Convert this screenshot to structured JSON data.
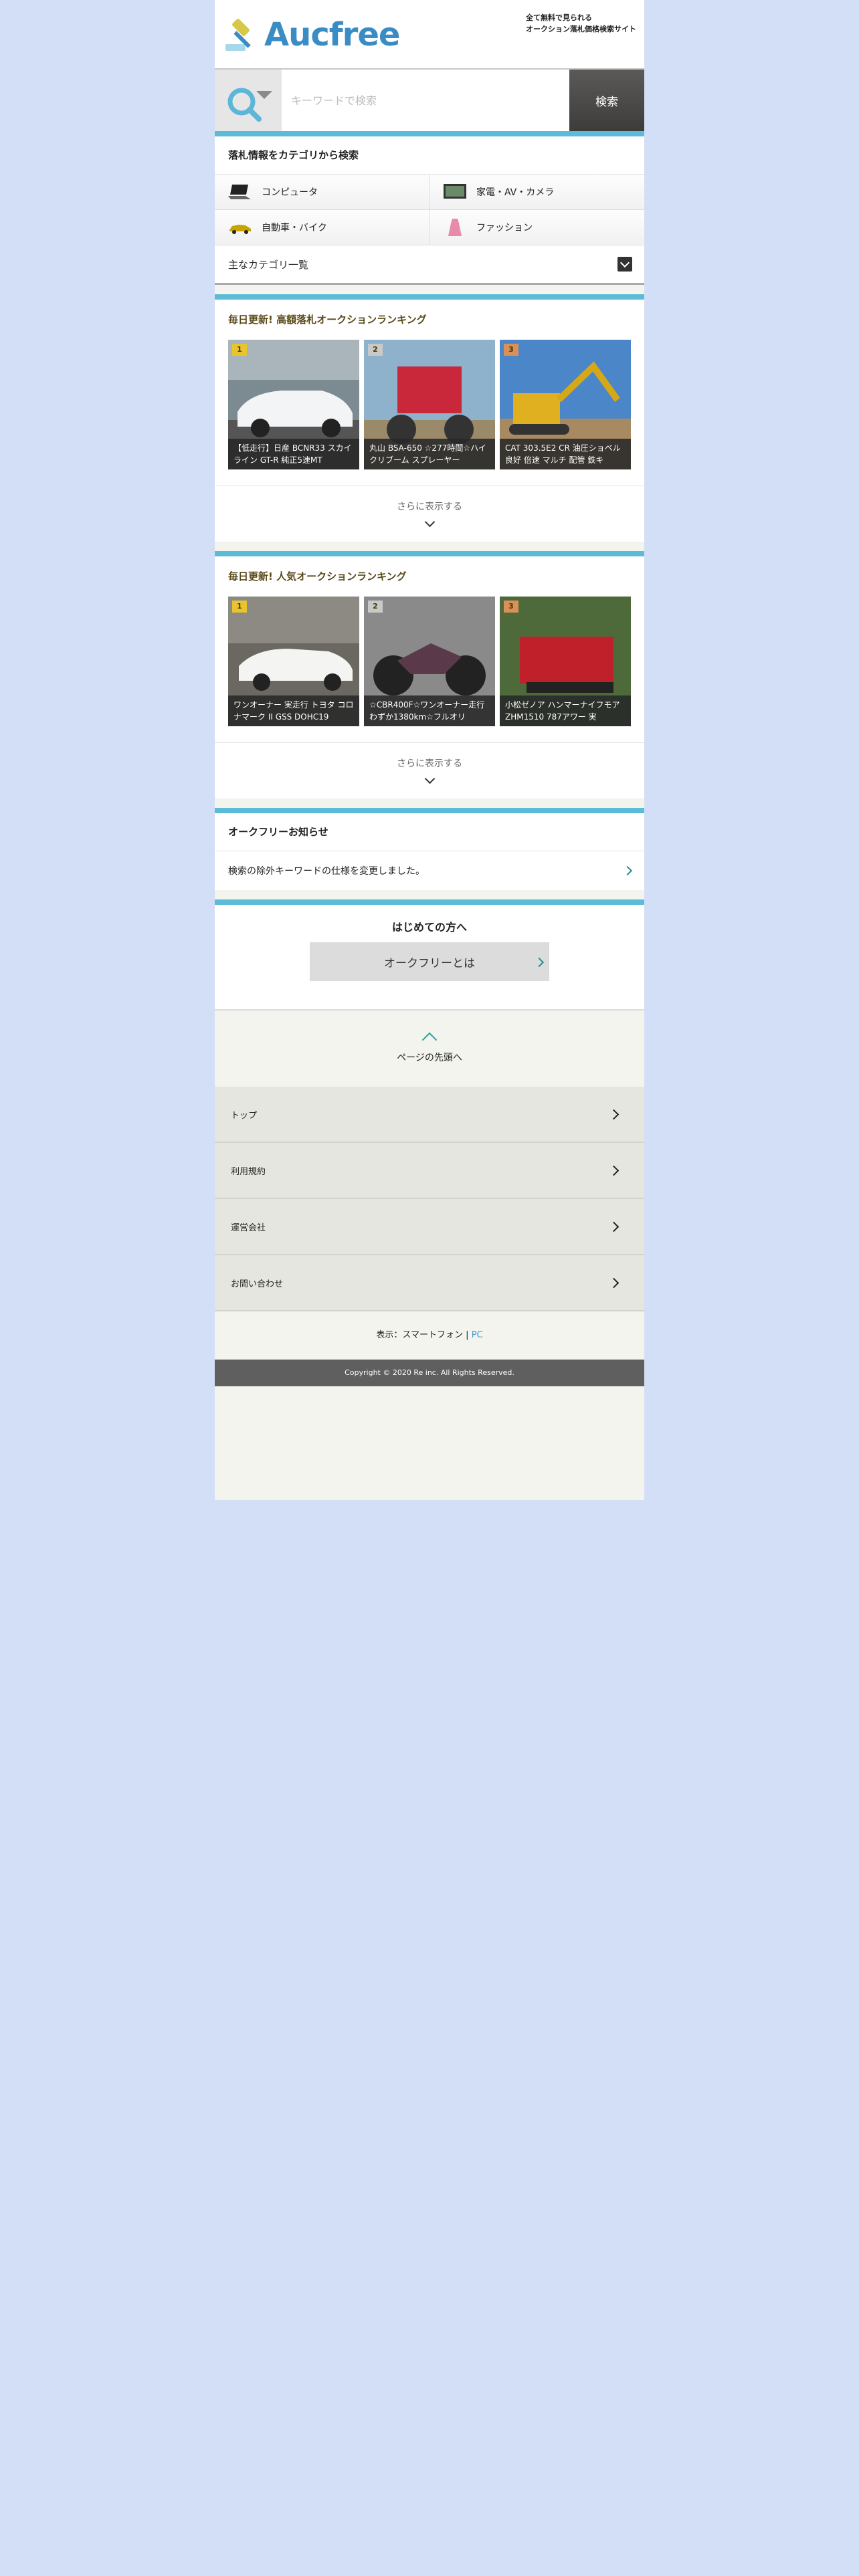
{
  "header": {
    "logo_text": "Aucfree",
    "tagline_line1": "全て無料で見られる",
    "tagline_line2": "オークション落札価格検索サイト"
  },
  "search": {
    "placeholder": "キーワードで検索",
    "value": "",
    "button_label": "検索"
  },
  "category_section": {
    "title": "落札情報をカテゴリから検索",
    "categories": [
      {
        "label": "コンピュータ",
        "icon": "laptop-icon"
      },
      {
        "label": "家電・AV・カメラ",
        "icon": "tv-icon"
      },
      {
        "label": "自動車・バイク",
        "icon": "car-icon"
      },
      {
        "label": "ファッション",
        "icon": "dress-icon"
      }
    ],
    "all_categories_label": "主なカテゴリ一覧"
  },
  "high_price_ranking": {
    "title": "毎日更新! 高額落札オークションランキング",
    "items": [
      {
        "rank": "1",
        "caption": "【低走行】日産 BCNR33 スカイライン GT-R 純正5速MT"
      },
      {
        "rank": "2",
        "caption": "丸山 BSA-650 ☆277時間☆ハイクリブーム スプレーヤー"
      },
      {
        "rank": "3",
        "caption": "CAT 303.5E2 CR 油圧ショベル 良好 倍速 マルチ 配管 鉄キ"
      }
    ],
    "more_label": "さらに表示する"
  },
  "popular_ranking": {
    "title": "毎日更新! 人気オークションランキング",
    "items": [
      {
        "rank": "1",
        "caption": "ワンオーナー 実走行 トヨタ コロナマーク II GSS DOHC19"
      },
      {
        "rank": "2",
        "caption": "☆CBR400F☆ワンオーナー走行わずか1380km☆フルオリ"
      },
      {
        "rank": "3",
        "caption": "小松ゼノア ハンマーナイフモア ZHM1510 787アワー 実"
      }
    ],
    "more_label": "さらに表示する"
  },
  "news": {
    "title": "オークフリーお知らせ",
    "items": [
      {
        "label": "検索の除外キーワードの仕様を変更しました。"
      }
    ]
  },
  "first_time": {
    "title": "はじめての方へ",
    "button_label": "オークフリーとは"
  },
  "footer": {
    "to_top_label": "ページの先頭へ",
    "links": [
      {
        "label": "トップ"
      },
      {
        "label": "利用規約"
      },
      {
        "label": "運営会社"
      },
      {
        "label": "お問い合わせ"
      }
    ],
    "view_prefix": "表示：",
    "view_smartphone": "スマートフォン",
    "view_separator": " | ",
    "view_pc": "PC",
    "copyright": "Copyright © 2020 Re inc. All Rights Reserved."
  },
  "colors": {
    "accent": "#5cbcd7",
    "page_bg": "#d3dff6",
    "content_bg": "#f2f4ed",
    "logo": "#3a8dc4"
  }
}
